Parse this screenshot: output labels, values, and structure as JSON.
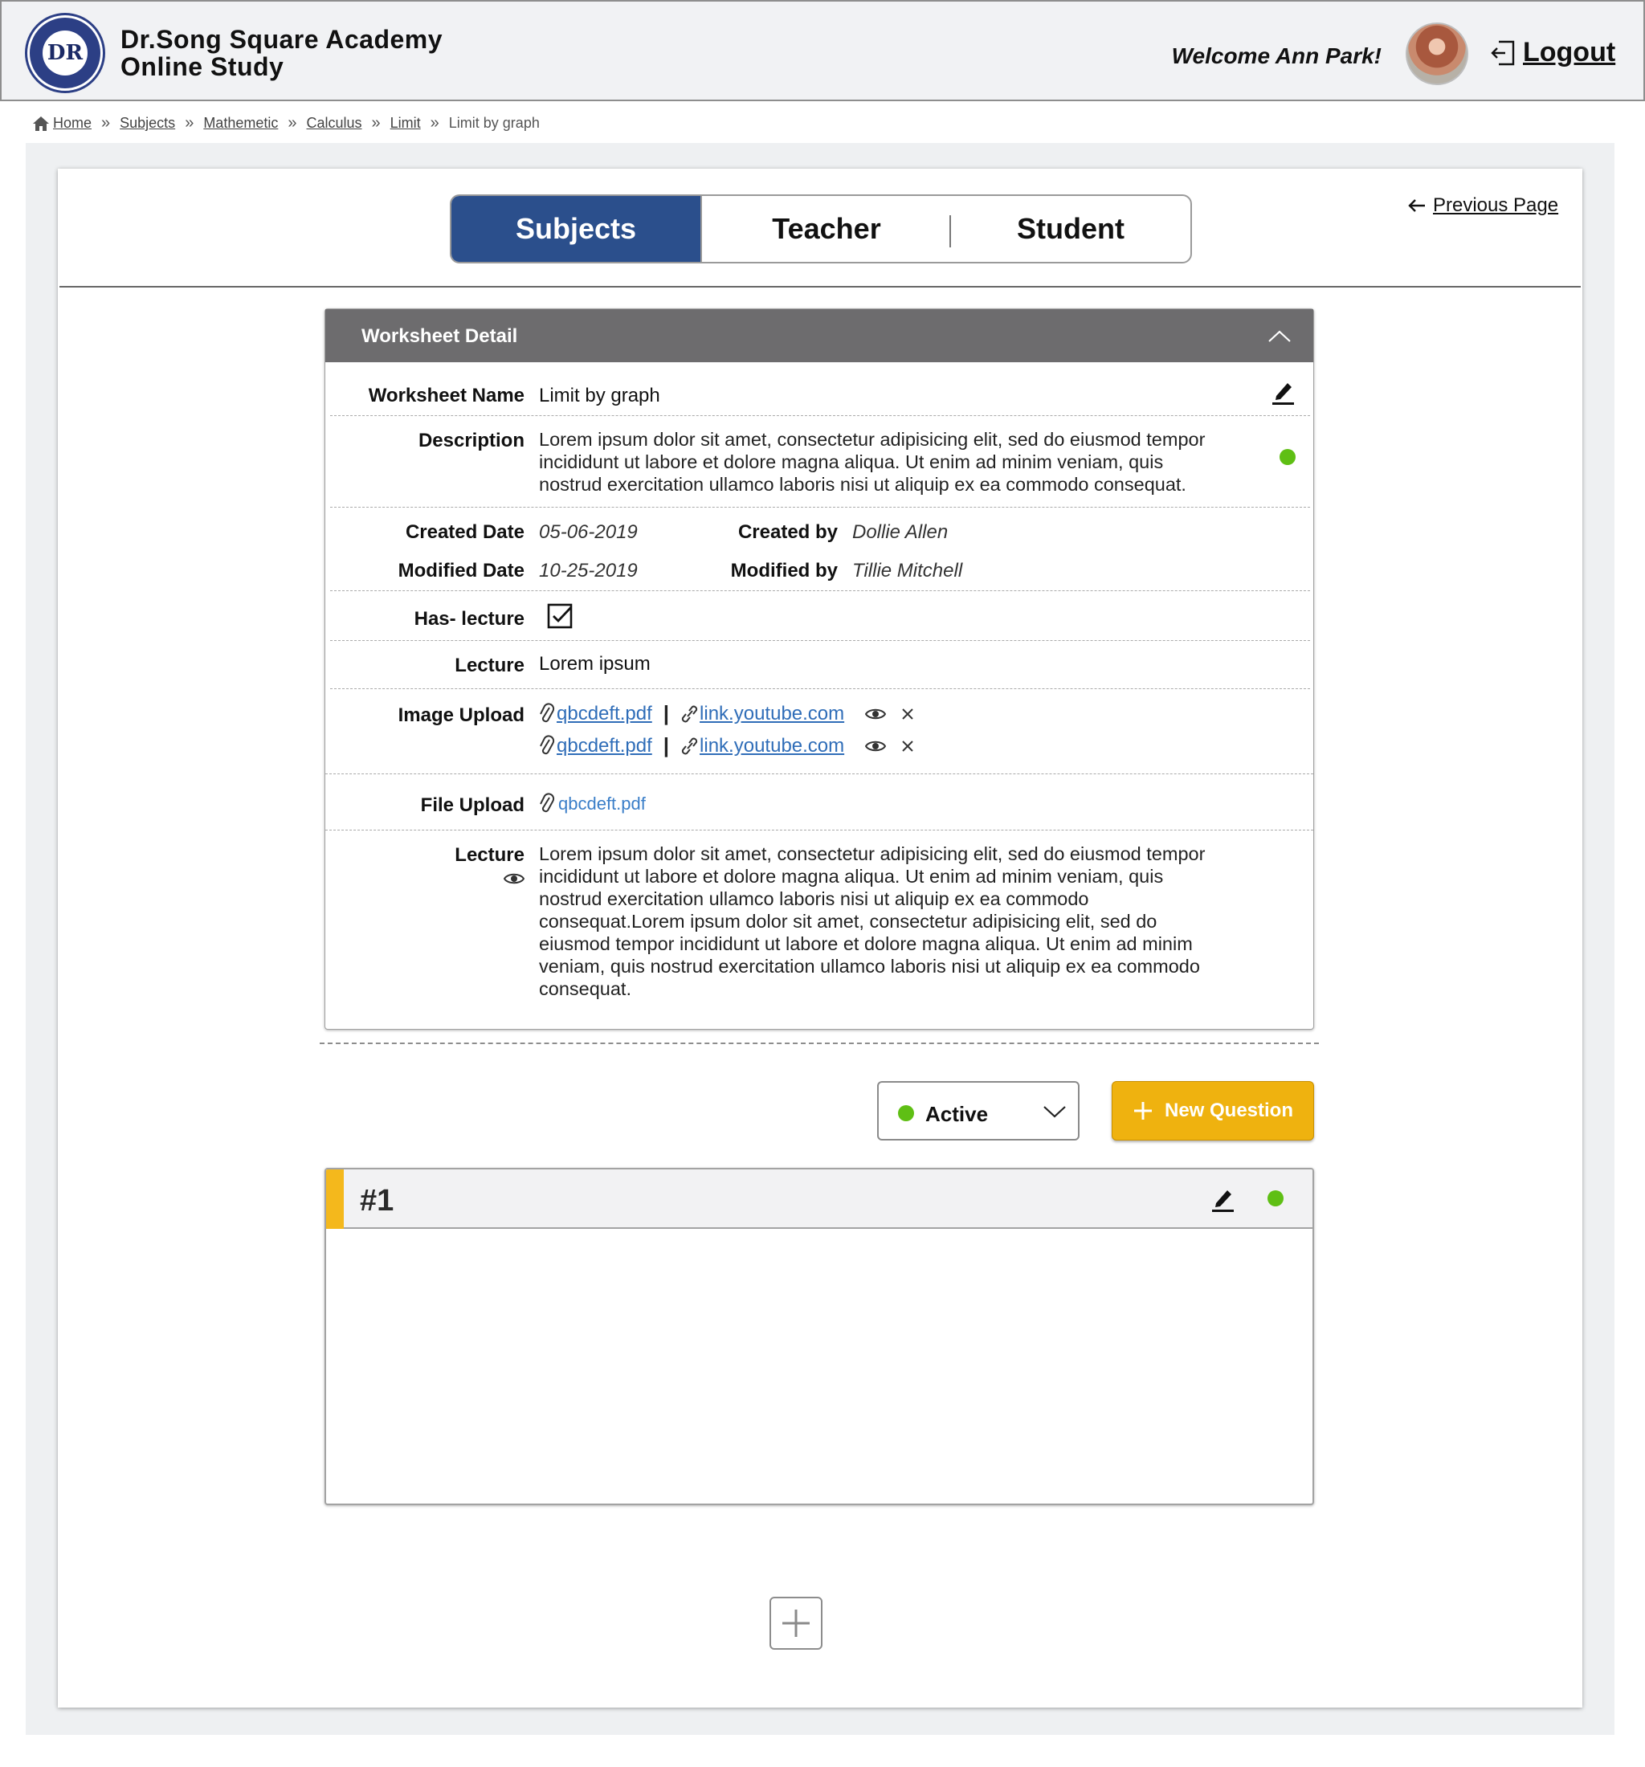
{
  "header": {
    "brand_line1": "Dr.Song Square Academy",
    "brand_line2": "Online Study",
    "logo_text": "DR",
    "welcome": "Welcome Ann Park!",
    "logout_label": "Logout"
  },
  "breadcrumb": {
    "items": [
      "Home",
      "Subjects",
      "Mathemetic",
      "Calculus",
      "Limit"
    ],
    "current": "Limit by graph"
  },
  "tabs": [
    {
      "label": "Subjects",
      "active": true
    },
    {
      "label": "Teacher",
      "active": false
    },
    {
      "label": "Student",
      "active": false
    }
  ],
  "previous_page": "Previous Page",
  "worksheet": {
    "panel_title": "Worksheet Detail",
    "name_label": "Worksheet Name",
    "name_value": "Limit by graph",
    "description_label": "Description",
    "description_value": "Lorem ipsum dolor sit amet, consectetur adipisicing elit, sed do eiusmod tempor incididunt ut labore et dolore magna aliqua. Ut enim ad minim veniam, quis nostrud exercitation ullamco laboris nisi ut aliquip ex ea commodo consequat.",
    "created_date_label": "Created Date",
    "created_date": "05-06-2019",
    "created_by_label": "Created by",
    "created_by": "Dollie Allen",
    "modified_date_label": "Modified Date",
    "modified_date": "10-25-2019",
    "modified_by_label": "Modified by",
    "modified_by": "Tillie Mitchell",
    "has_lecture_label": "Has- lecture",
    "has_lecture_checked": true,
    "lecture_label": "Lecture",
    "lecture_value": "Lorem ipsum",
    "image_upload_label": "Image Upload",
    "image_uploads": [
      {
        "file": "qbcdeft.pdf",
        "link": "link.youtube.com"
      },
      {
        "file": "qbcdeft.pdf",
        "link": "link.youtube.com"
      }
    ],
    "file_upload_label": "File Upload",
    "file_upload": "qbcdeft.pdf",
    "lecture_text_label": "Lecture",
    "lecture_text": "Lorem ipsum dolor sit amet, consectetur adipisicing elit, sed do eiusmod tempor incididunt ut labore et dolore magna aliqua. Ut enim ad minim veniam, quis nostrud exercitation ullamco laboris nisi ut aliquip ex ea commodo consequat.Lorem ipsum dolor sit amet, consectetur adipisicing elit, sed do eiusmod tempor incididunt ut labore et dolore magna aliqua. Ut enim ad minim veniam, quis nostrud exercitation ullamco laboris nisi ut aliquip ex ea commodo consequat."
  },
  "status_select": {
    "value": "Active"
  },
  "new_question_label": "New Question",
  "questions": [
    {
      "number": "#1"
    }
  ],
  "colors": {
    "primary": "#2b4f8c",
    "panel_header": "#6d6c6e",
    "status_green": "#5fbf14",
    "accent_yellow": "#efb20f",
    "link_blue": "#2f6db8"
  },
  "icons": [
    "home-icon",
    "chevron-up-icon",
    "pencil-icon",
    "checkbox-icon",
    "paperclip-icon",
    "link-icon",
    "eye-icon",
    "close-icon",
    "chevron-down-icon",
    "plus-icon",
    "arrow-left-icon",
    "logout-icon"
  ]
}
